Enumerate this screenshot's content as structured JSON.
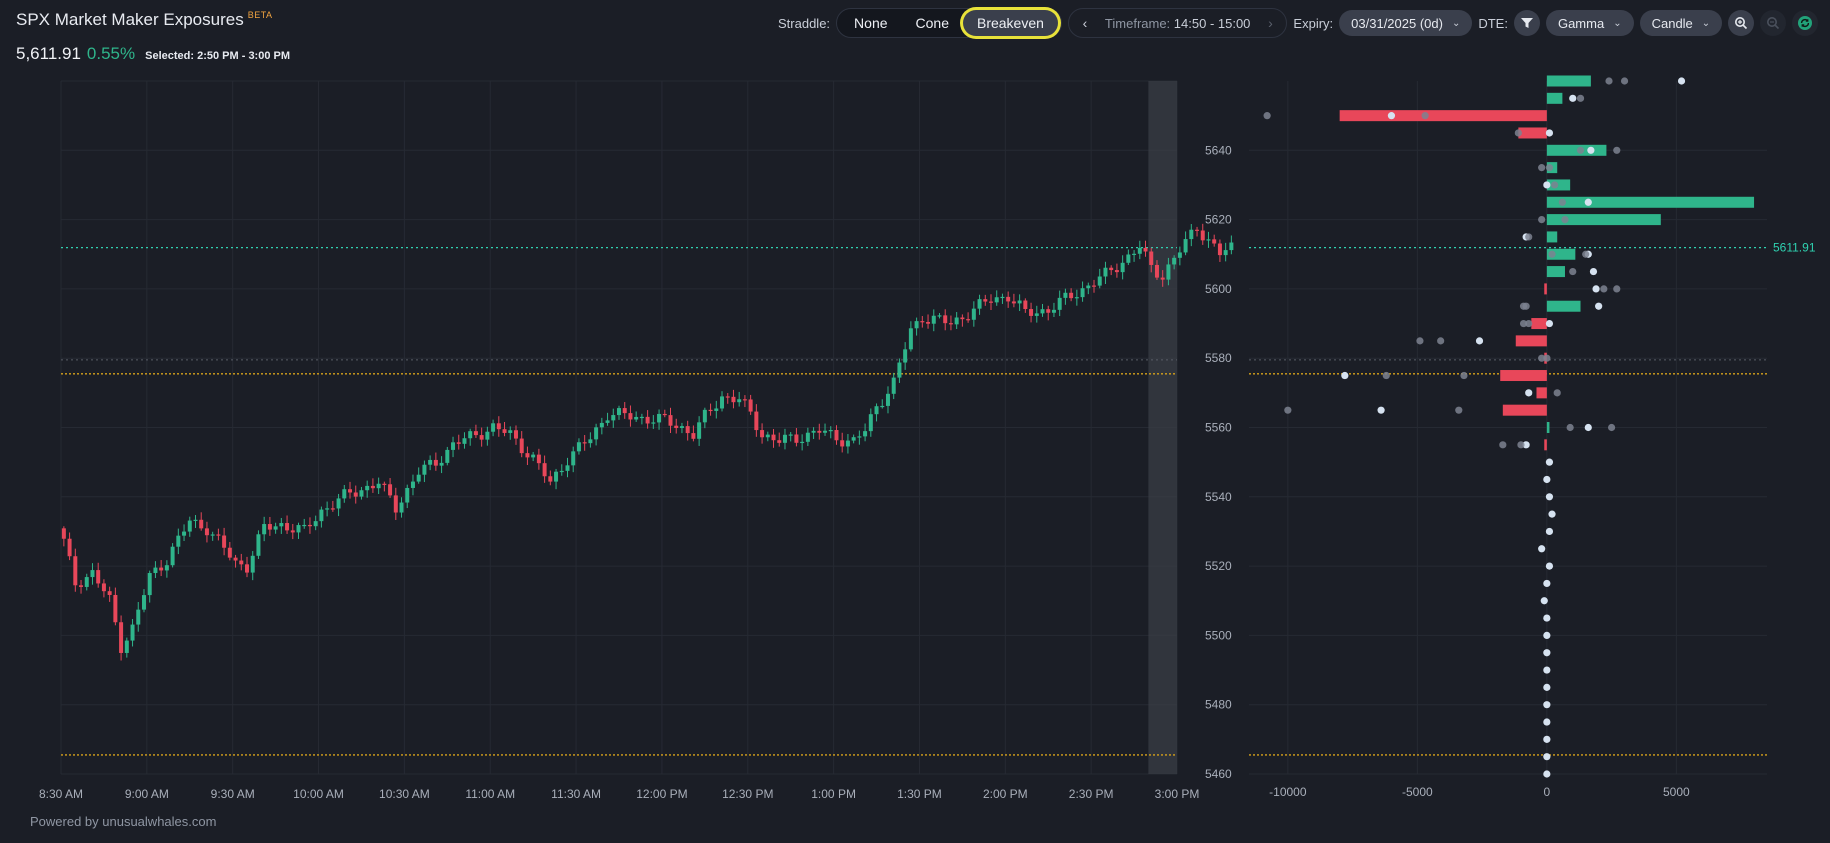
{
  "header": {
    "title": "SPX Market Maker Exposures",
    "beta_badge": "BETA",
    "price": "5,611.91",
    "change": "0.55%",
    "selected": "Selected: 2:50 PM - 3:00 PM"
  },
  "controls": {
    "straddle_label": "Straddle:",
    "straddle_options": [
      "None",
      "Cone",
      "Breakeven"
    ],
    "straddle_selected": "Breakeven",
    "timeframe_label": "Timeframe:",
    "timeframe_value": "14:50 - 15:00",
    "expiry_label": "Expiry:",
    "expiry_value": "03/31/2025 (0d)",
    "dte_label": "DTE:",
    "greek_value": "Gamma",
    "chart_style_value": "Candle"
  },
  "footer": {
    "powered_by": "Powered by unusualwhales.com"
  },
  "colors": {
    "background": "#1b1e26",
    "up": "#2fb58b",
    "down": "#e8475a",
    "price_line": "#2fd1b0",
    "breakeven_line": "#d7a21a",
    "highlight": "#e8e23a"
  },
  "chart_data": [
    {
      "type": "candlestick",
      "x_tick_labels": [
        "8:30 AM",
        "9:00 AM",
        "9:30 AM",
        "10:00 AM",
        "10:30 AM",
        "11:00 AM",
        "11:30 AM",
        "12:00 PM",
        "12:30 PM",
        "1:00 PM",
        "1:30 PM",
        "2:00 PM",
        "2:30 PM",
        "3:00 PM"
      ],
      "ylim": [
        5460,
        5660
      ],
      "grid": true,
      "interval_minutes": 2,
      "start_time": "8:30 AM",
      "close_points": [
        [
          0,
          5527
        ],
        [
          2,
          5515
        ],
        [
          5,
          5518
        ],
        [
          8,
          5510
        ],
        [
          10,
          5497
        ],
        [
          12,
          5502
        ],
        [
          15,
          5517
        ],
        [
          18,
          5522
        ],
        [
          22,
          5533
        ],
        [
          25,
          5531
        ],
        [
          28,
          5525
        ],
        [
          30,
          5521
        ],
        [
          32,
          5520
        ],
        [
          35,
          5531
        ],
        [
          38,
          5532
        ],
        [
          42,
          5530
        ],
        [
          45,
          5536
        ],
        [
          50,
          5541
        ],
        [
          55,
          5544
        ],
        [
          58,
          5537
        ],
        [
          62,
          5547
        ],
        [
          65,
          5550
        ],
        [
          68,
          5555
        ],
        [
          72,
          5558
        ],
        [
          75,
          5560
        ],
        [
          78,
          5558
        ],
        [
          82,
          5551
        ],
        [
          85,
          5544
        ],
        [
          88,
          5551
        ],
        [
          92,
          5557
        ],
        [
          95,
          5564
        ],
        [
          100,
          5563
        ],
        [
          105,
          5562
        ],
        [
          108,
          5560
        ],
        [
          110,
          5558
        ],
        [
          112,
          5563
        ],
        [
          115,
          5569
        ],
        [
          118,
          5568
        ],
        [
          120,
          5564
        ],
        [
          122,
          5558
        ],
        [
          125,
          5556
        ],
        [
          128,
          5557
        ],
        [
          132,
          5559
        ],
        [
          135,
          5557
        ],
        [
          138,
          5556
        ],
        [
          140,
          5559
        ],
        [
          142,
          5566
        ],
        [
          145,
          5573
        ],
        [
          148,
          5588
        ],
        [
          150,
          5592
        ],
        [
          155,
          5590
        ],
        [
          158,
          5593
        ],
        [
          162,
          5597
        ],
        [
          165,
          5598
        ],
        [
          168,
          5593
        ],
        [
          172,
          5594
        ],
        [
          175,
          5597
        ],
        [
          178,
          5600
        ],
        [
          182,
          5604
        ],
        [
          185,
          5608
        ],
        [
          188,
          5612
        ],
        [
          190,
          5606
        ],
        [
          192,
          5604
        ],
        [
          195,
          5611
        ],
        [
          198,
          5618
        ],
        [
          200,
          5614
        ],
        [
          202,
          5610
        ],
        [
          204,
          5612
        ]
      ],
      "price_line": 5611.91,
      "breakeven_upper": 5575.5,
      "breakeven_lower": 5465.5,
      "reference_line": 5579.5,
      "selected_window": [
        "2:50 PM",
        "3:00 PM"
      ]
    },
    {
      "type": "bar",
      "orientation": "horizontal",
      "xlim": [
        -11500,
        8500
      ],
      "x_tick_labels": [
        "-10000",
        "-5000",
        "0",
        "5000"
      ],
      "ylim": [
        5460,
        5660
      ],
      "y_tick_labels": [
        "5460",
        "5480",
        "5500",
        "5520",
        "5540",
        "5560",
        "5580",
        "5600",
        "5620",
        "5640"
      ],
      "price_label": "5611.91",
      "strikes": [
        5660,
        5655,
        5650,
        5645,
        5640,
        5635,
        5630,
        5625,
        5620,
        5615,
        5610,
        5605,
        5600,
        5595,
        5590,
        5585,
        5580,
        5575,
        5570,
        5565,
        5560,
        5555
      ],
      "values": [
        1700,
        600,
        -8000,
        -1100,
        2300,
        400,
        900,
        8000,
        4400,
        400,
        1100,
        700,
        -100,
        1300,
        -600,
        -1200,
        -100,
        -1800,
        -400,
        -1700,
        100,
        -100
      ],
      "dots": [
        [
          5660,
          5200
        ],
        [
          5660,
          2400
        ],
        [
          5660,
          3000
        ],
        [
          5655,
          1000
        ],
        [
          5655,
          1300
        ],
        [
          5650,
          -10800
        ],
        [
          5650,
          -6000
        ],
        [
          5650,
          -4700
        ],
        [
          5645,
          -1100
        ],
        [
          5645,
          100
        ],
        [
          5640,
          2700
        ],
        [
          5640,
          1300
        ],
        [
          5640,
          1700
        ],
        [
          5635,
          -200
        ],
        [
          5635,
          100
        ],
        [
          5630,
          0
        ],
        [
          5630,
          300
        ],
        [
          5625,
          600
        ],
        [
          5625,
          1600
        ],
        [
          5620,
          -200
        ],
        [
          5620,
          700
        ],
        [
          5615,
          -800
        ],
        [
          5615,
          -700
        ],
        [
          5610,
          200
        ],
        [
          5610,
          1600
        ],
        [
          5610,
          1500
        ],
        [
          5605,
          1000
        ],
        [
          5605,
          1800
        ],
        [
          5600,
          2700
        ],
        [
          5600,
          2200
        ],
        [
          5600,
          1900
        ],
        [
          5595,
          -800
        ],
        [
          5595,
          -900
        ],
        [
          5595,
          2000
        ],
        [
          5590,
          -900
        ],
        [
          5590,
          -700
        ],
        [
          5590,
          100
        ],
        [
          5585,
          -4900
        ],
        [
          5585,
          -4100
        ],
        [
          5585,
          -2600
        ],
        [
          5580,
          -200
        ],
        [
          5580,
          0
        ],
        [
          5575,
          -7800
        ],
        [
          5575,
          -6200
        ],
        [
          5575,
          -3200
        ],
        [
          5570,
          -700
        ],
        [
          5570,
          400
        ],
        [
          5565,
          -10000
        ],
        [
          5565,
          -6400
        ],
        [
          5565,
          -3400
        ],
        [
          5560,
          900
        ],
        [
          5560,
          1600
        ],
        [
          5560,
          2500
        ],
        [
          5555,
          -1700
        ],
        [
          5555,
          -800
        ],
        [
          5555,
          -1000
        ]
      ],
      "tail_dots": [
        [
          5550,
          100
        ],
        [
          5545,
          0
        ],
        [
          5540,
          100
        ],
        [
          5535,
          200
        ],
        [
          5530,
          100
        ],
        [
          5525,
          -200
        ],
        [
          5520,
          100
        ],
        [
          5515,
          0
        ],
        [
          5510,
          -100
        ],
        [
          5505,
          0
        ],
        [
          5500,
          0
        ],
        [
          5495,
          0
        ],
        [
          5490,
          0
        ],
        [
          5485,
          0
        ],
        [
          5480,
          0
        ],
        [
          5475,
          0
        ],
        [
          5470,
          0
        ],
        [
          5465,
          0
        ],
        [
          5460,
          0
        ]
      ]
    }
  ]
}
